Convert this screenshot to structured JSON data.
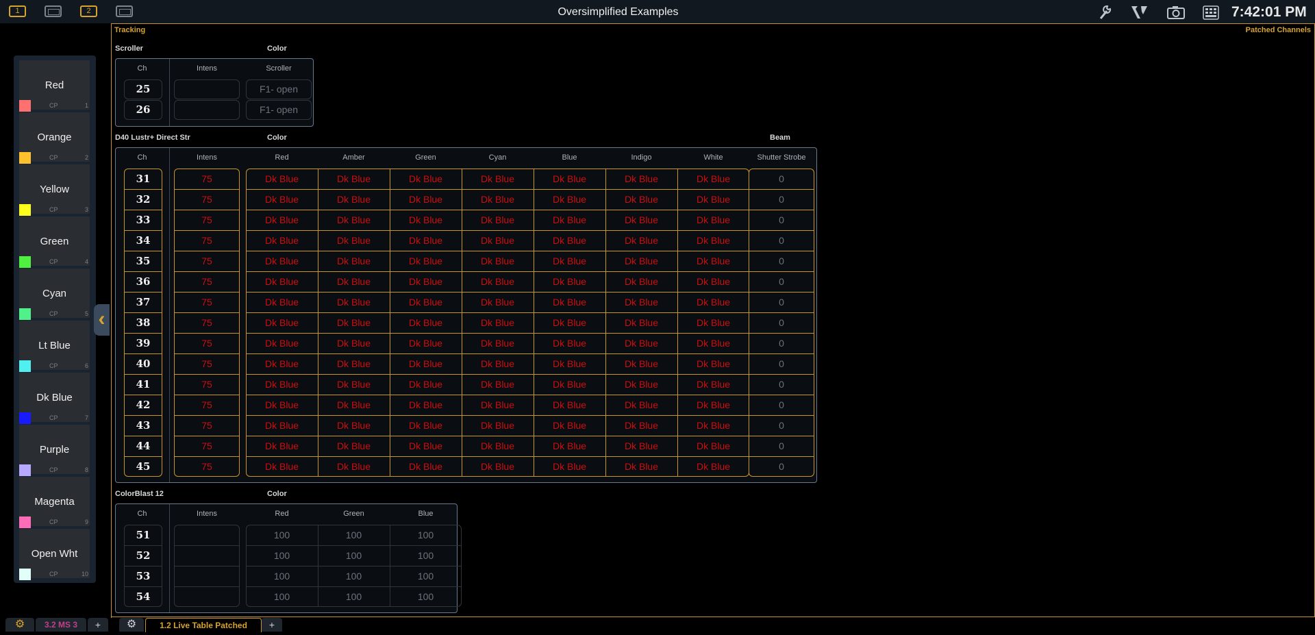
{
  "workspace_tabs": [
    "1",
    "",
    "2",
    ""
  ],
  "app_title": "Oversimplified Examples",
  "clock": "7:42:01 PM",
  "top_icons": [
    "wrench-icon",
    "fixtures-icon",
    "camera-icon",
    "keypad-icon"
  ],
  "tracking_label": "Tracking",
  "patched_label": "Patched Channels",
  "palette": {
    "cp_label": "CP",
    "items": [
      {
        "label": "Red",
        "num": "1",
        "color": "#ff7070"
      },
      {
        "label": "Orange",
        "num": "2",
        "color": "#ffc02e"
      },
      {
        "label": "Yellow",
        "num": "3",
        "color": "#ffff1e"
      },
      {
        "label": "Green",
        "num": "4",
        "color": "#50f040"
      },
      {
        "label": "Cyan",
        "num": "5",
        "color": "#50f08a"
      },
      {
        "label": "Lt Blue",
        "num": "6",
        "color": "#50f0f0"
      },
      {
        "label": "Dk Blue",
        "num": "7",
        "color": "#1a1aff"
      },
      {
        "label": "Purple",
        "num": "8",
        "color": "#b8a8ff"
      },
      {
        "label": "Magenta",
        "num": "9",
        "color": "#ff6cb8"
      },
      {
        "label": "Open Wht",
        "num": "10",
        "color": "#e0fff8"
      }
    ]
  },
  "scroller": {
    "name": "Scroller",
    "group": "Color",
    "columns": [
      "Ch",
      "Intens",
      "Scroller"
    ],
    "rows": [
      {
        "ch": "25",
        "intens": "",
        "scroller": "F1- open"
      },
      {
        "ch": "26",
        "intens": "",
        "scroller": "F1- open"
      }
    ]
  },
  "d40": {
    "name": "D40 Lustr+ Direct Str",
    "group": "Color",
    "group2": "Beam",
    "columns": [
      "Ch",
      "Intens",
      "Red",
      "Amber",
      "Green",
      "Cyan",
      "Blue",
      "Indigo",
      "White",
      "Shutter Strobe"
    ],
    "rows": [
      {
        "ch": "31",
        "intens": "75",
        "colors": [
          "Dk Blue",
          "Dk Blue",
          "Dk Blue",
          "Dk Blue",
          "Dk Blue",
          "Dk Blue",
          "Dk Blue"
        ],
        "shutter": "0"
      },
      {
        "ch": "32",
        "intens": "75",
        "colors": [
          "Dk Blue",
          "Dk Blue",
          "Dk Blue",
          "Dk Blue",
          "Dk Blue",
          "Dk Blue",
          "Dk Blue"
        ],
        "shutter": "0"
      },
      {
        "ch": "33",
        "intens": "75",
        "colors": [
          "Dk Blue",
          "Dk Blue",
          "Dk Blue",
          "Dk Blue",
          "Dk Blue",
          "Dk Blue",
          "Dk Blue"
        ],
        "shutter": "0"
      },
      {
        "ch": "34",
        "intens": "75",
        "colors": [
          "Dk Blue",
          "Dk Blue",
          "Dk Blue",
          "Dk Blue",
          "Dk Blue",
          "Dk Blue",
          "Dk Blue"
        ],
        "shutter": "0"
      },
      {
        "ch": "35",
        "intens": "75",
        "colors": [
          "Dk Blue",
          "Dk Blue",
          "Dk Blue",
          "Dk Blue",
          "Dk Blue",
          "Dk Blue",
          "Dk Blue"
        ],
        "shutter": "0"
      },
      {
        "ch": "36",
        "intens": "75",
        "colors": [
          "Dk Blue",
          "Dk Blue",
          "Dk Blue",
          "Dk Blue",
          "Dk Blue",
          "Dk Blue",
          "Dk Blue"
        ],
        "shutter": "0"
      },
      {
        "ch": "37",
        "intens": "75",
        "colors": [
          "Dk Blue",
          "Dk Blue",
          "Dk Blue",
          "Dk Blue",
          "Dk Blue",
          "Dk Blue",
          "Dk Blue"
        ],
        "shutter": "0"
      },
      {
        "ch": "38",
        "intens": "75",
        "colors": [
          "Dk Blue",
          "Dk Blue",
          "Dk Blue",
          "Dk Blue",
          "Dk Blue",
          "Dk Blue",
          "Dk Blue"
        ],
        "shutter": "0"
      },
      {
        "ch": "39",
        "intens": "75",
        "colors": [
          "Dk Blue",
          "Dk Blue",
          "Dk Blue",
          "Dk Blue",
          "Dk Blue",
          "Dk Blue",
          "Dk Blue"
        ],
        "shutter": "0"
      },
      {
        "ch": "40",
        "intens": "75",
        "colors": [
          "Dk Blue",
          "Dk Blue",
          "Dk Blue",
          "Dk Blue",
          "Dk Blue",
          "Dk Blue",
          "Dk Blue"
        ],
        "shutter": "0"
      },
      {
        "ch": "41",
        "intens": "75",
        "colors": [
          "Dk Blue",
          "Dk Blue",
          "Dk Blue",
          "Dk Blue",
          "Dk Blue",
          "Dk Blue",
          "Dk Blue"
        ],
        "shutter": "0"
      },
      {
        "ch": "42",
        "intens": "75",
        "colors": [
          "Dk Blue",
          "Dk Blue",
          "Dk Blue",
          "Dk Blue",
          "Dk Blue",
          "Dk Blue",
          "Dk Blue"
        ],
        "shutter": "0"
      },
      {
        "ch": "43",
        "intens": "75",
        "colors": [
          "Dk Blue",
          "Dk Blue",
          "Dk Blue",
          "Dk Blue",
          "Dk Blue",
          "Dk Blue",
          "Dk Blue"
        ],
        "shutter": "0"
      },
      {
        "ch": "44",
        "intens": "75",
        "colors": [
          "Dk Blue",
          "Dk Blue",
          "Dk Blue",
          "Dk Blue",
          "Dk Blue",
          "Dk Blue",
          "Dk Blue"
        ],
        "shutter": "0"
      },
      {
        "ch": "45",
        "intens": "75",
        "colors": [
          "Dk Blue",
          "Dk Blue",
          "Dk Blue",
          "Dk Blue",
          "Dk Blue",
          "Dk Blue",
          "Dk Blue"
        ],
        "shutter": "0"
      }
    ]
  },
  "colorblast": {
    "name": "ColorBlast 12",
    "group": "Color",
    "columns": [
      "Ch",
      "Intens",
      "Red",
      "Green",
      "Blue"
    ],
    "rows": [
      {
        "ch": "51",
        "intens": "",
        "values": [
          "100",
          "100",
          "100"
        ]
      },
      {
        "ch": "52",
        "intens": "",
        "values": [
          "100",
          "100",
          "100"
        ]
      },
      {
        "ch": "53",
        "intens": "",
        "values": [
          "100",
          "100",
          "100"
        ]
      },
      {
        "ch": "54",
        "intens": "",
        "values": [
          "100",
          "100",
          "100"
        ]
      }
    ]
  },
  "bottom_tabs": {
    "tab1": "3.2 MS 3",
    "tab2": "1.2 Live Table Patched",
    "add": "+"
  },
  "colors": {
    "accent": "#c89628",
    "tracked_value": "#cc0f0f",
    "tab1_text": "#c0408a",
    "tab2_text": "#d8a42a"
  }
}
